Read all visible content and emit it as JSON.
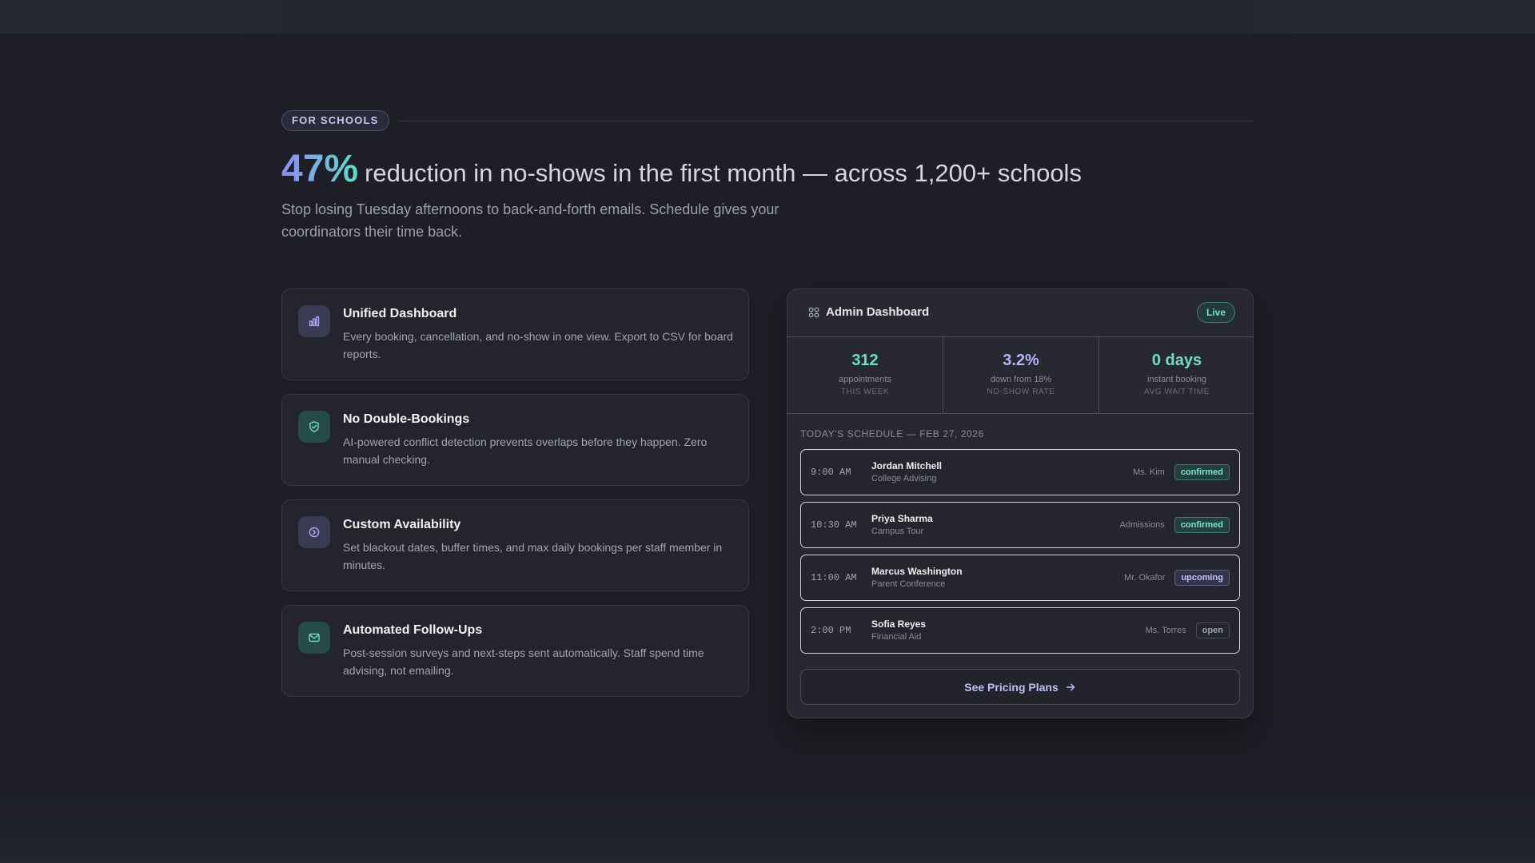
{
  "hero": {
    "eyebrow": "FOR SCHOOLS",
    "stat": "47%",
    "headline": "reduction in no-shows in the first month — across 1,200+ schools",
    "subtitle": "Stop losing Tuesday afternoons to back-and-forth emails. Schedule gives your coordinators their time back."
  },
  "features": [
    {
      "icon": "bar-chart-icon",
      "title": "Unified Dashboard",
      "description": "Every booking, cancellation, and no-show in one view. Export to CSV for board reports."
    },
    {
      "icon": "shield-check-icon",
      "title": "No Double-Bookings",
      "description": "AI-powered conflict detection prevents overlaps before they happen. Zero manual checking."
    },
    {
      "icon": "clock-icon",
      "title": "Custom Availability",
      "description": "Set blackout dates, buffer times, and max daily bookings per staff member in minutes."
    },
    {
      "icon": "mail-icon",
      "title": "Automated Follow-Ups",
      "description": "Post-session surveys and next-steps sent automatically. Staff spend time advising, not emailing."
    }
  ],
  "dashboard": {
    "title": "Admin Dashboard",
    "badge": "Live",
    "stats": [
      {
        "value": "312",
        "label": "appointments",
        "caption": "THIS WEEK"
      },
      {
        "value": "3.2%",
        "label": "down from 18%",
        "caption": "NO-SHOW RATE"
      },
      {
        "value": "0 days",
        "label": "instant booking",
        "caption": "AVG WAIT TIME"
      }
    ],
    "schedule_label": "TODAY'S SCHEDULE — FEB 27, 2026",
    "rows": [
      {
        "time": "9:00 AM",
        "name": "Jordan Mitchell",
        "type": "College Advising",
        "staff": "Ms. Kim",
        "status": "confirmed"
      },
      {
        "time": "10:30 AM",
        "name": "Priya Sharma",
        "type": "Campus Tour",
        "staff": "Admissions",
        "status": "confirmed"
      },
      {
        "time": "11:00 AM",
        "name": "Marcus Washington",
        "type": "Parent Conference",
        "staff": "Mr. Okafor",
        "status": "upcoming"
      },
      {
        "time": "2:00 PM",
        "name": "Sofia Reyes",
        "type": "Financial Aid",
        "staff": "Ms. Torres",
        "status": "open"
      }
    ],
    "cta": "See Pricing Plans"
  },
  "colors": {
    "background": "#1e1f26",
    "accent_purple": "#8b8cf3",
    "accent_teal": "#5fdcc8"
  }
}
